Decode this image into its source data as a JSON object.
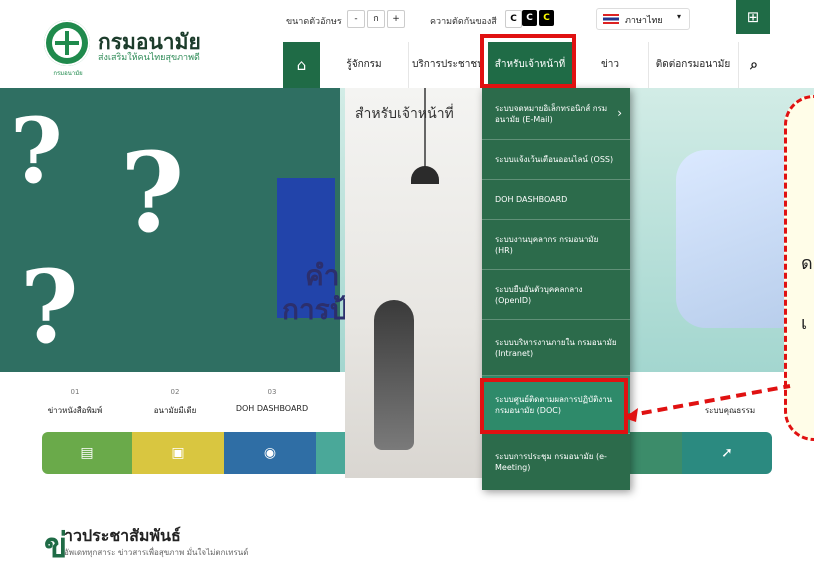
{
  "header": {
    "site_title": "กรมอนามัย",
    "site_subtitle": "ส่งเสริมให้คนไทยสุขภาพดี",
    "logo_caption": "กรมอนามัย",
    "font_size_label": "ขนาดตัวอักษร",
    "font_size_buttons": [
      "-",
      "ก",
      "+"
    ],
    "contrast_label": "ความตัดกันของสี",
    "contrast_buttons": [
      "C",
      "C",
      "C"
    ],
    "language": "ภาษาไทย"
  },
  "nav": {
    "items": [
      "รู้จักกรม",
      "บริการประชาชน",
      "สำหรับเจ้าหน้าที่",
      "ข่าวประชาสัมพันธ์",
      "ติดต่อกรมอนามัย"
    ]
  },
  "banner": {
    "text_line1": "คำ",
    "text_line2": "การป้",
    "question_marks": [
      "?",
      "?",
      "?"
    ]
  },
  "dropdown": {
    "heading": "สำหรับเจ้าหน้าที่",
    "items": [
      "ระบบจดหมายอิเล็กทรอนิกส์ กรมอนามัย (E-Mail)",
      "ระบบแจ้งเว้นเตือนออนไลน์ (OSS)",
      "DOH DASHBOARD",
      "ระบบงานบุคลากร กรมอนามัย (HR)",
      "ระบบยืนยันตัวบุคคลกลาง (OpenID)",
      "ระบบบริหารงานภายใน กรมอนามัย (Intranet)",
      "ระบบศูนย์ติดตามผลการปฏิบัติงาน กรมอนามัย (DOC)",
      "ระบบการประชุม กรมอนามัย (e-Meeting)"
    ]
  },
  "quick_links": {
    "items": [
      {
        "num": "01",
        "label": "ข่าวหนังสือพิมพ์"
      },
      {
        "num": "02",
        "label": "อนามัยมีเดีย"
      },
      {
        "num": "03",
        "label": "DOH DASHBOARD"
      }
    ],
    "last_label": "ระบบคุณธรรม"
  },
  "callout": {
    "chars": [
      "ด",
      "เ"
    ]
  },
  "pr": {
    "big_letter": "ข่",
    "title": "าวประชาสัมพันธ์",
    "subtitle": "อัพเดททุกสาระ ข่าวสารเพื่อสุขภาพ มั่นใจไม่ตกเทรนด์"
  },
  "colors": {
    "primary_green": "#1f6b46",
    "menu_green": "#2c6b4b",
    "highlight_red": "#e01111",
    "tile_colors": [
      "#6aaa4a",
      "#d9c640",
      "#2f6ea5",
      "#4aa899",
      "#3c8c6a",
      "#5a9a4a",
      "#2b8a80"
    ]
  }
}
